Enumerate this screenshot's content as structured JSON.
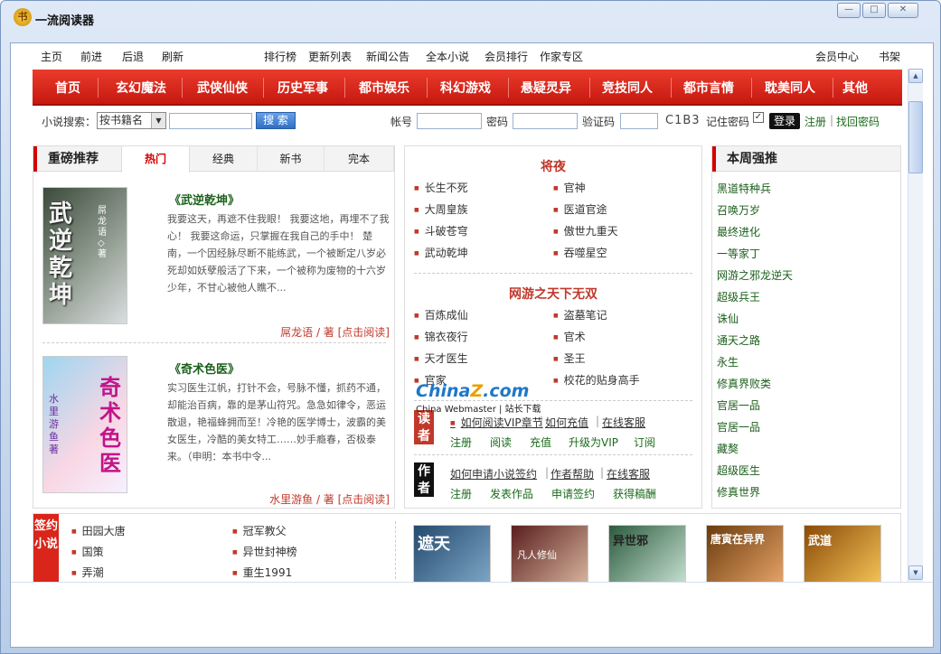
{
  "window": {
    "title": "一流阅读器",
    "icon": "书",
    "minimize": "—",
    "maximize": "□",
    "close": "✕"
  },
  "topnav": {
    "left": [
      "主页",
      "前进",
      "后退",
      "刷新"
    ],
    "middle": [
      "排行榜",
      "更新列表",
      "新闻公告",
      "全本小说",
      "会员排行",
      "作家专区"
    ],
    "right": [
      "会员中心",
      "书架"
    ]
  },
  "categories": [
    "首页",
    "玄幻魔法",
    "武侠仙侠",
    "历史军事",
    "都市娱乐",
    "科幻游戏",
    "悬疑灵异",
    "竞技同人",
    "都市言情",
    "耽美同人",
    "其他"
  ],
  "search": {
    "label": "小说搜索：",
    "select": "按书籍名",
    "button": "搜 索",
    "account_label": "帐号",
    "password_label": "密码",
    "captcha_label": "验证码",
    "captcha_code": "C1B3",
    "remember_label": "记住密码",
    "login": "登录",
    "register": "注册",
    "recover": "找回密码"
  },
  "left_box": {
    "header": "重磅推荐",
    "tabs": [
      "热门",
      "经典",
      "新书",
      "完本"
    ],
    "books": [
      {
        "title": "《武逆乾坤》",
        "desc": "我要这天，再遮不住我眼！ 我要这地，再埋不了我心！ 我要这命运，只掌握在我自己的手中！ 楚南，一个因经脉尽断不能练武，一个被断定八岁必死却如妖孽般活了下来，一个被称为废物的十六岁少年，不甘心被他人瞧不...",
        "author": "屌龙语",
        "read": "/ 著 [点击阅读]",
        "cover_text": "武逆乾坤",
        "cover_sub": "屌龙语 ◇ 著"
      },
      {
        "title": "《奇术色医》",
        "desc": "实习医生江帆，打针不会，号脉不懂，抓药不通，却能治百病，靠的是茅山符咒。急急如律令，恶运散退，艳福蜂拥而至！冷艳的医学博士，波霸的美女医生，冷酷的美女特工……妙手瘾春，否极泰来。（申明：本书中令...",
        "author": "水里游鱼",
        "read": "/ 著 [点击阅读]",
        "cover_text": "奇术色医",
        "cover_sub": "水里游鱼著"
      }
    ]
  },
  "mid_box": {
    "section1": {
      "title": "将夜",
      "items": [
        "长生不死",
        "官神",
        "大周皇族",
        "医道官途",
        "斗破苍穹",
        "傲世九重天",
        "武动乾坤",
        "吞噬星空"
      ]
    },
    "section2": {
      "title": "网游之天下无双",
      "items": [
        "百炼成仙",
        "盗墓笔记",
        "锦衣夜行",
        "官术",
        "天才医生",
        "圣王",
        "官家",
        "校花的贴身高手"
      ]
    },
    "reader": {
      "badge": "读者",
      "links1": [
        "如何阅读VIP章节",
        "如何充值",
        "在线客服"
      ],
      "links2": [
        "注册",
        "阅读",
        "充值",
        "升级为VIP",
        "订阅"
      ]
    },
    "author": {
      "badge": "作者",
      "links1": [
        "如何申请小说签约",
        "作者帮助",
        "在线客服"
      ],
      "links2": [
        "注册",
        "发表作品",
        "申请签约",
        "获得稿酬"
      ]
    }
  },
  "right_box": {
    "header": "本周强推",
    "items": [
      "黑道特种兵",
      "召唤万岁",
      "最终进化",
      "一等家丁",
      "网游之邪龙逆天",
      "超级兵王",
      "诛仙",
      "通天之路",
      "永生",
      "修真界败类",
      "官居一品",
      "官居一品",
      "藏獒",
      "超级医生",
      "修真世界"
    ]
  },
  "bottom": {
    "badge": "签约小说",
    "col1": [
      "田园大唐",
      "国策",
      "弄潮"
    ],
    "col2": [
      "冠军教父",
      "异世封神榜",
      "重生1991"
    ],
    "thumbs": [
      "遮天",
      "凡人修仙",
      "异世邪",
      "唐寅在异界",
      "武道"
    ]
  },
  "watermark": {
    "brand": "China",
    "brand_z": "Z",
    ".com": ".com",
    "sub": "China Webmaster | 站长下载"
  },
  "colors": {
    "accent_red": "#d40000",
    "nav_bar": "#d9251a",
    "link_green": "#1a6b1a"
  }
}
